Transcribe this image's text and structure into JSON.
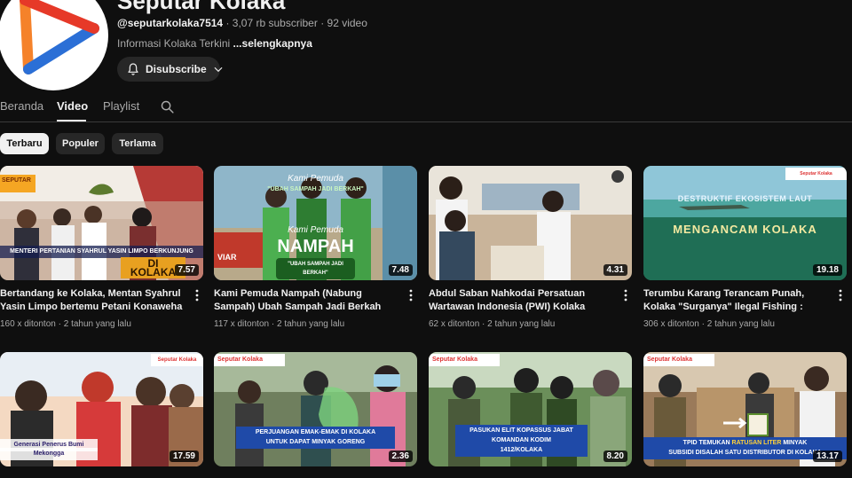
{
  "channel": {
    "name": "Seputar Kolaka",
    "handle": "@seputarkolaka7514",
    "subscribers": "3,07 rb subscriber",
    "video_count": "92 video",
    "separator": "·",
    "description": "Informasi Kolaka Terkini",
    "more_label": "...selengkapnya",
    "subscribe_label": "Disubscribe",
    "brand_colors": {
      "red": "#e63928",
      "orange": "#f5822a",
      "blue": "#2b6fd6"
    }
  },
  "tabs": [
    {
      "label": "Beranda",
      "active": false
    },
    {
      "label": "Video",
      "active": true
    },
    {
      "label": "Playlist",
      "active": false
    }
  ],
  "search_icon": "search-icon",
  "filters": [
    {
      "label": "Terbaru",
      "active": true
    },
    {
      "label": "Populer",
      "active": false
    },
    {
      "label": "Terlama",
      "active": false
    }
  ],
  "videos": [
    {
      "title": "Bertandang ke Kolaka, Mentan Syahrul Yasin Limpo bertemu Petani Konaweha",
      "views": "160 x ditonton",
      "age": "2 tahun yang lalu",
      "duration": "7.57",
      "caption_1": "MENTERI PERTANIAN SYAHRUL YASIN LIMPO BERKUNJUNG",
      "caption_2": "DI KOLAKA",
      "logo_text": "SEPUTAR"
    },
    {
      "title": "Kami Pemuda Nampah (Nabung Sampah) Ubah Sampah Jadi Berkah",
      "views": "117 x ditonton",
      "age": "2 tahun yang lalu",
      "duration": "7.48",
      "caption_1": "Kami Pemuda",
      "caption_2": "NAMPAH",
      "caption_3": "\"UBAH SAMPAH JADI BERKAH\"",
      "caption_4": "Kami Pemuda",
      "caption_5": "\"UBAH SAMPAH JADI BERKAH\"",
      "logo_text": "VIAR"
    },
    {
      "title": "Abdul Saban Nahkodai Persatuan Wartawan Indonesia (PWI) Kolaka",
      "views": "62 x ditonton",
      "age": "2 tahun yang lalu",
      "duration": "4.31"
    },
    {
      "title": "Terumbu Karang Terancam Punah, Kolaka \"Surganya\" Ilegal Fishing : Special Report…",
      "views": "306 x ditonton",
      "age": "2 tahun yang lalu",
      "duration": "19.18",
      "caption_1": "DESTRUKTIF EKOSISTEM LAUT",
      "caption_2": "MENGANCAM KOLAKA",
      "logo_text": "Seputar Kolaka"
    },
    {
      "title": "",
      "views": "",
      "age": "",
      "duration": "17.59",
      "caption_1": "Generasi Penerus Bumi",
      "caption_2": "Mekongga",
      "logo_text": "Seputar Kolaka"
    },
    {
      "title": "",
      "views": "",
      "age": "",
      "duration": "2.36",
      "caption_1": "PERJUANGAN EMAK-EMAK DI KOLAKA",
      "caption_2": "UNTUK DAPAT MINYAK GORENG",
      "logo_text": "Seputar Kolaka"
    },
    {
      "title": "",
      "views": "",
      "age": "",
      "duration": "8.20",
      "caption_1": "PASUKAN ELIT KOPASSUS JABAT",
      "caption_2": "KOMANDAN KODIM",
      "caption_3": "1412/KOLAKA",
      "logo_text": "Seputar Kolaka"
    },
    {
      "title": "",
      "views": "",
      "age": "",
      "duration": "13.17",
      "caption_1": "TPID TEMUKAN",
      "caption_1b": "RATUSAN LITER",
      "caption_1c": "MINYAK",
      "caption_2": "SUBSIDI DISALAH SATU DISTRIBUTOR DI KOLAKA",
      "logo_text": "Seputar Kolaka"
    }
  ]
}
